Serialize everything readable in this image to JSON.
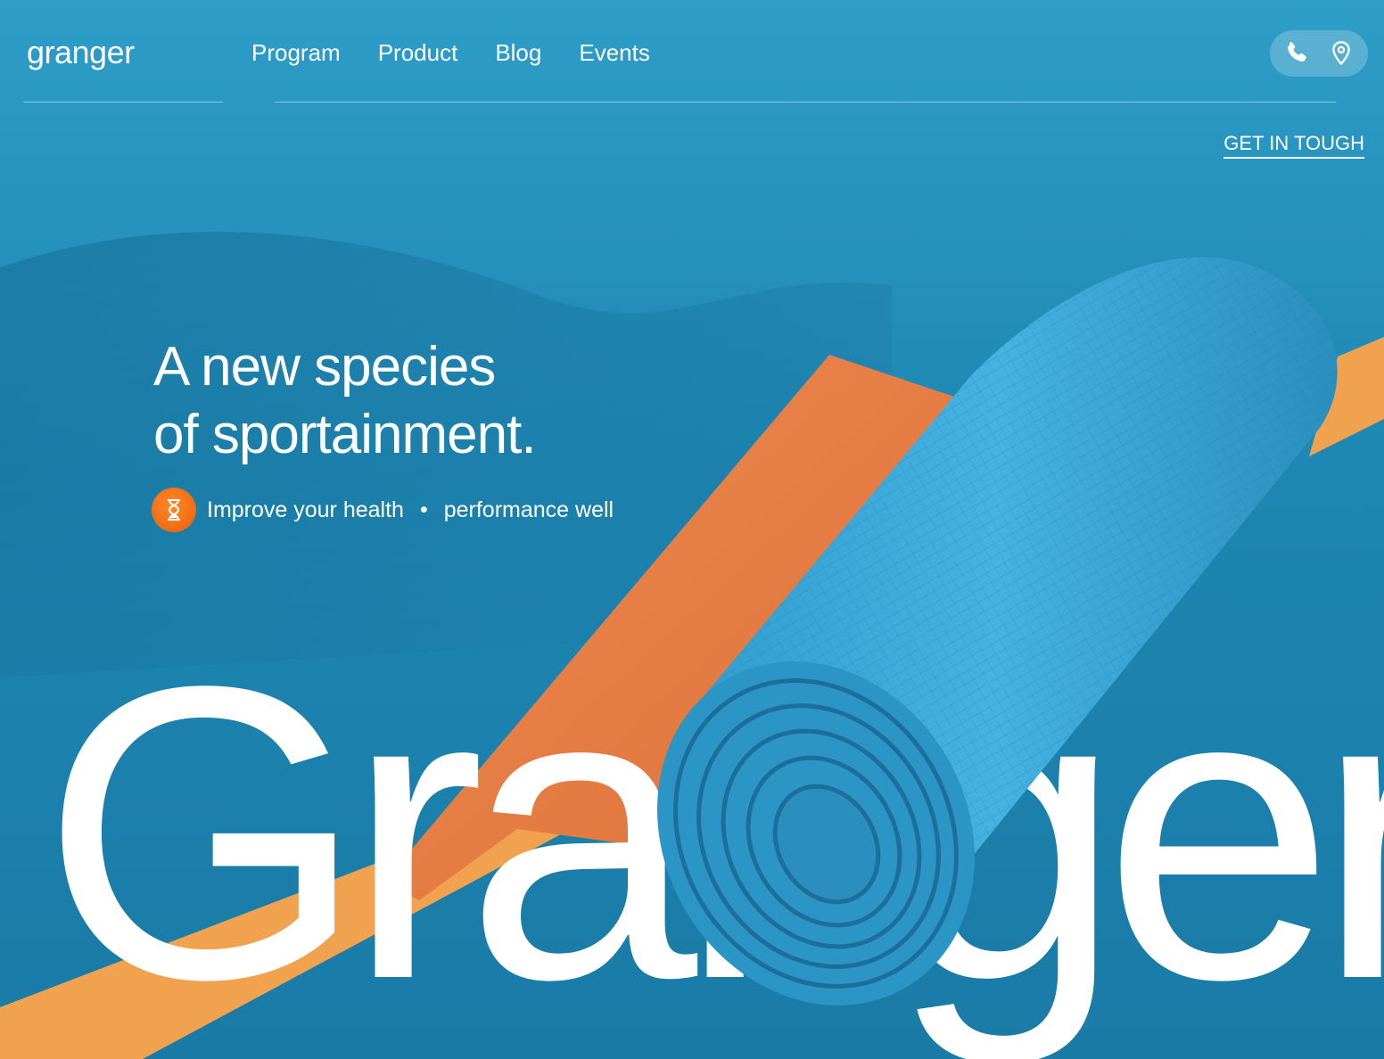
{
  "header": {
    "logo": "granger",
    "nav": [
      {
        "label": "Program"
      },
      {
        "label": "Product"
      },
      {
        "label": "Blog"
      },
      {
        "label": "Events"
      }
    ],
    "contact_icons": [
      "phone-icon",
      "location-pin-icon"
    ]
  },
  "cta": {
    "label": "GET IN TOUGH"
  },
  "hero": {
    "headline_line1": "A new species",
    "headline_line2": "of sportainment.",
    "subline_part1": "Improve your health",
    "separator": "•",
    "subline_part2": "performance well",
    "badge_icon": "hourglass-icon",
    "brand_word": "Granger"
  },
  "colors": {
    "background": "#1f8ab7",
    "mat_blue": "#3aa9d8",
    "mat_orange": "#e8834a",
    "stripe_orange": "#f0a24f",
    "badge_orange": "#f06a12",
    "text": "#ffffff"
  }
}
